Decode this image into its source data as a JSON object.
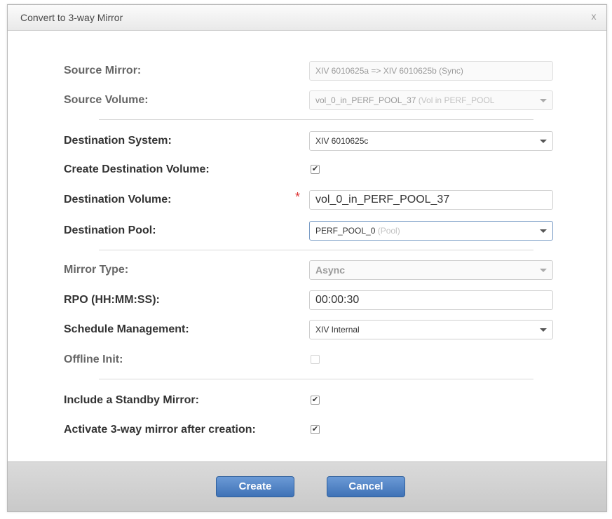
{
  "dialog": {
    "title": "Convert to 3-way Mirror",
    "close_label": "x"
  },
  "fields": {
    "source_mirror": {
      "label": "Source Mirror:",
      "value": "XIV 6010625a => XIV 6010625b (Sync)"
    },
    "source_volume": {
      "label": "Source Volume:",
      "value": "vol_0_in_PERF_POOL_37",
      "hint": " (Vol in PERF_POOL"
    },
    "destination_system": {
      "label": "Destination System:",
      "value": "XIV 6010625c"
    },
    "create_destination_volume": {
      "label": "Create Destination Volume:",
      "checked": true
    },
    "destination_volume": {
      "label": "Destination Volume:",
      "value": "vol_0_in_PERF_POOL_37",
      "required_mark": "*"
    },
    "destination_pool": {
      "label": "Destination Pool:",
      "value": "PERF_POOL_0",
      "hint": " (Pool)"
    },
    "mirror_type": {
      "label": "Mirror Type:",
      "value": "Async"
    },
    "rpo": {
      "label": "RPO (HH:MM:SS):",
      "value": "00:00:30"
    },
    "schedule_management": {
      "label": "Schedule Management:",
      "value": "XIV Internal"
    },
    "offline_init": {
      "label": "Offline Init:",
      "checked": false
    },
    "include_standby": {
      "label": "Include a Standby Mirror:",
      "checked": true
    },
    "activate_after": {
      "label": "Activate 3-way mirror after creation:",
      "checked": true
    }
  },
  "buttons": {
    "create": "Create",
    "cancel": "Cancel"
  },
  "check_glyph": "✔"
}
